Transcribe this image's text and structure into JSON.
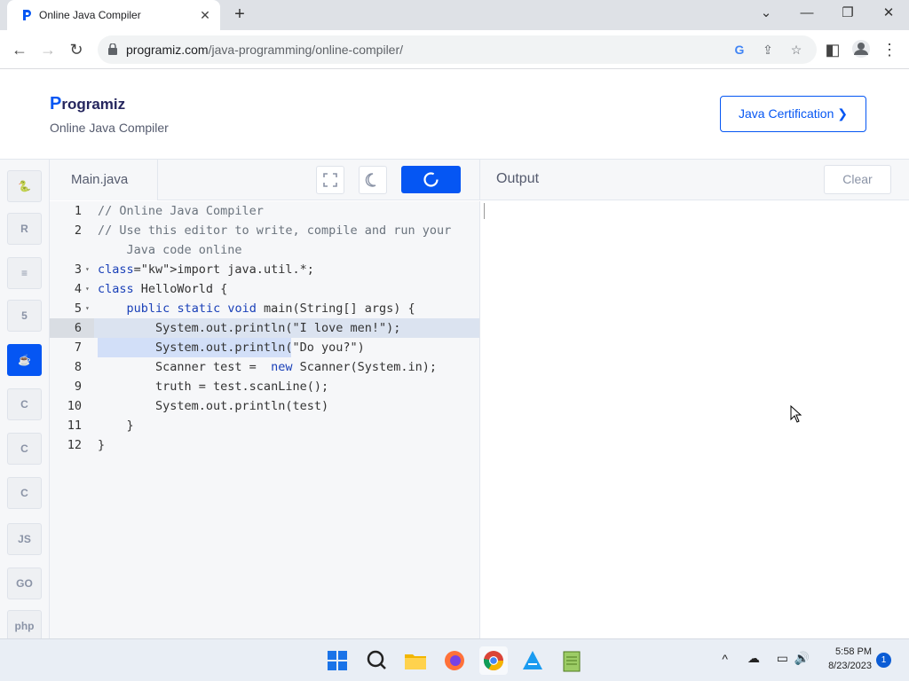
{
  "browser": {
    "tab_title": "Online Java Compiler",
    "url_host": "programiz.com",
    "url_path": "/java-programming/online-compiler/"
  },
  "header": {
    "logo_text": "rogramiz",
    "logo_p": "P",
    "subtitle": "Online Java Compiler",
    "cert_button": "Java Certification ❯"
  },
  "sidebar": {
    "languages": [
      {
        "name": "python-icon",
        "glyph": "🐍"
      },
      {
        "name": "r-icon",
        "glyph": "R"
      },
      {
        "name": "sql-icon",
        "glyph": "≡"
      },
      {
        "name": "html-icon",
        "glyph": "5"
      },
      {
        "name": "java-icon",
        "glyph": "☕",
        "active": true
      },
      {
        "name": "c-icon",
        "glyph": "C"
      },
      {
        "name": "cpp-icon",
        "glyph": "C"
      },
      {
        "name": "csharp-icon",
        "glyph": "C"
      },
      {
        "name": "js-icon",
        "glyph": "JS"
      },
      {
        "name": "go-icon",
        "glyph": "GO"
      },
      {
        "name": "php-icon",
        "glyph": "php"
      }
    ]
  },
  "editor": {
    "file_name": "Main.java",
    "lines": [
      {
        "n": "1",
        "text": "// Online Java Compiler"
      },
      {
        "n": "2",
        "text": "// Use this editor to write, compile and run your"
      },
      {
        "n": "",
        "text": "    Java code online"
      },
      {
        "n": "3",
        "text": "import java.util.*;"
      },
      {
        "n": "4",
        "text": "class HelloWorld {"
      },
      {
        "n": "5",
        "text": "    public static void main(String[] args) {"
      },
      {
        "n": "6",
        "text": "        System.out.println(\"I love men!\");"
      },
      {
        "n": "7",
        "text": "        System.out.println(\"Do you?\")"
      },
      {
        "n": "8",
        "text": "        Scanner test =  new Scanner(System.in);"
      },
      {
        "n": "9",
        "text": "        truth = test.scanLine();"
      },
      {
        "n": "10",
        "text": "        System.out.println(test)"
      },
      {
        "n": "11",
        "text": "    }"
      },
      {
        "n": "12",
        "text": "}"
      }
    ]
  },
  "output": {
    "title": "Output",
    "clear_label": "Clear"
  },
  "taskbar": {
    "time": "5:58 PM",
    "date": "8/23/2023",
    "notification_count": "1"
  },
  "colors": {
    "accent": "#0556f3",
    "brand_dark": "#25265e"
  }
}
